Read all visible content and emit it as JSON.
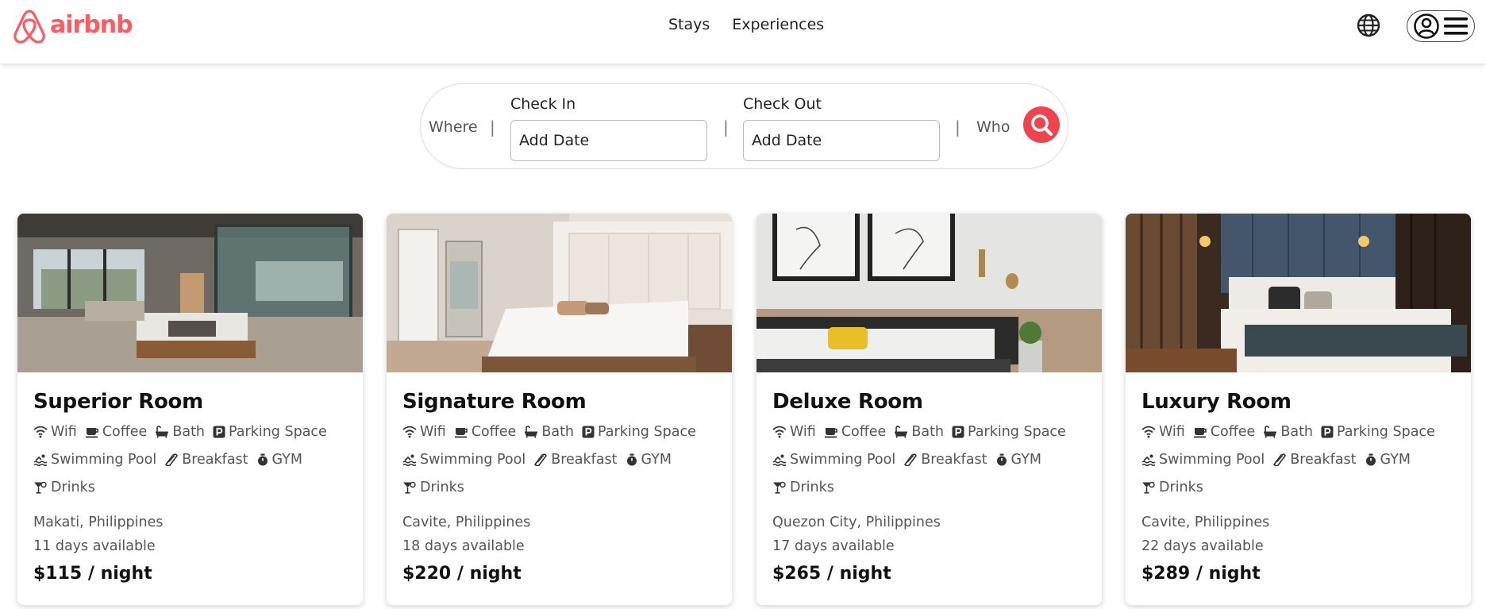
{
  "header": {
    "brand": "airbnb",
    "brand_color": "#ff5a5f",
    "nav": [
      "Stays",
      "Experiences"
    ],
    "icons": [
      "airbnb-logo-icon",
      "globe-icon",
      "user-icon",
      "menu-icon"
    ]
  },
  "search": {
    "where_label": "Where",
    "separator": "|",
    "check_in_label": "Check In",
    "check_in_value": "Add Date",
    "check_out_label": "Check Out",
    "check_out_value": "Add Date",
    "who_label": "Who",
    "button_color": "#f0434b",
    "button_icon": "search-icon"
  },
  "amenity_icons": [
    "wifi-icon",
    "coffee-icon",
    "bath-icon",
    "parking-icon",
    "swimming-pool-icon",
    "breakfast-icon",
    "gym-icon",
    "drinks-icon"
  ],
  "cards": [
    {
      "title": "Superior Room",
      "amenities": [
        "Wifi",
        "Coffee",
        "Bath",
        "Parking Space",
        "Swimming Pool",
        "Breakfast",
        "GYM",
        "Drinks"
      ],
      "location": "Makati, Philippines",
      "availability": "11 days available",
      "price": "$115 / night"
    },
    {
      "title": "Signature Room",
      "amenities": [
        "Wifi",
        "Coffee",
        "Bath",
        "Parking Space",
        "Swimming Pool",
        "Breakfast",
        "GYM",
        "Drinks"
      ],
      "location": "Cavite, Philippines",
      "availability": "18 days available",
      "price": "$220 / night"
    },
    {
      "title": "Deluxe Room",
      "amenities": [
        "Wifi",
        "Coffee",
        "Bath",
        "Parking Space",
        "Swimming Pool",
        "Breakfast",
        "GYM",
        "Drinks"
      ],
      "location": "Quezon City, Philippines",
      "availability": "17 days available",
      "price": "$265 / night"
    },
    {
      "title": "Luxury Room",
      "amenities": [
        "Wifi",
        "Coffee",
        "Bath",
        "Parking Space",
        "Swimming Pool",
        "Breakfast",
        "GYM",
        "Drinks"
      ],
      "location": "Cavite, Philippines",
      "availability": "22 days available",
      "price": "$289 / night"
    }
  ]
}
